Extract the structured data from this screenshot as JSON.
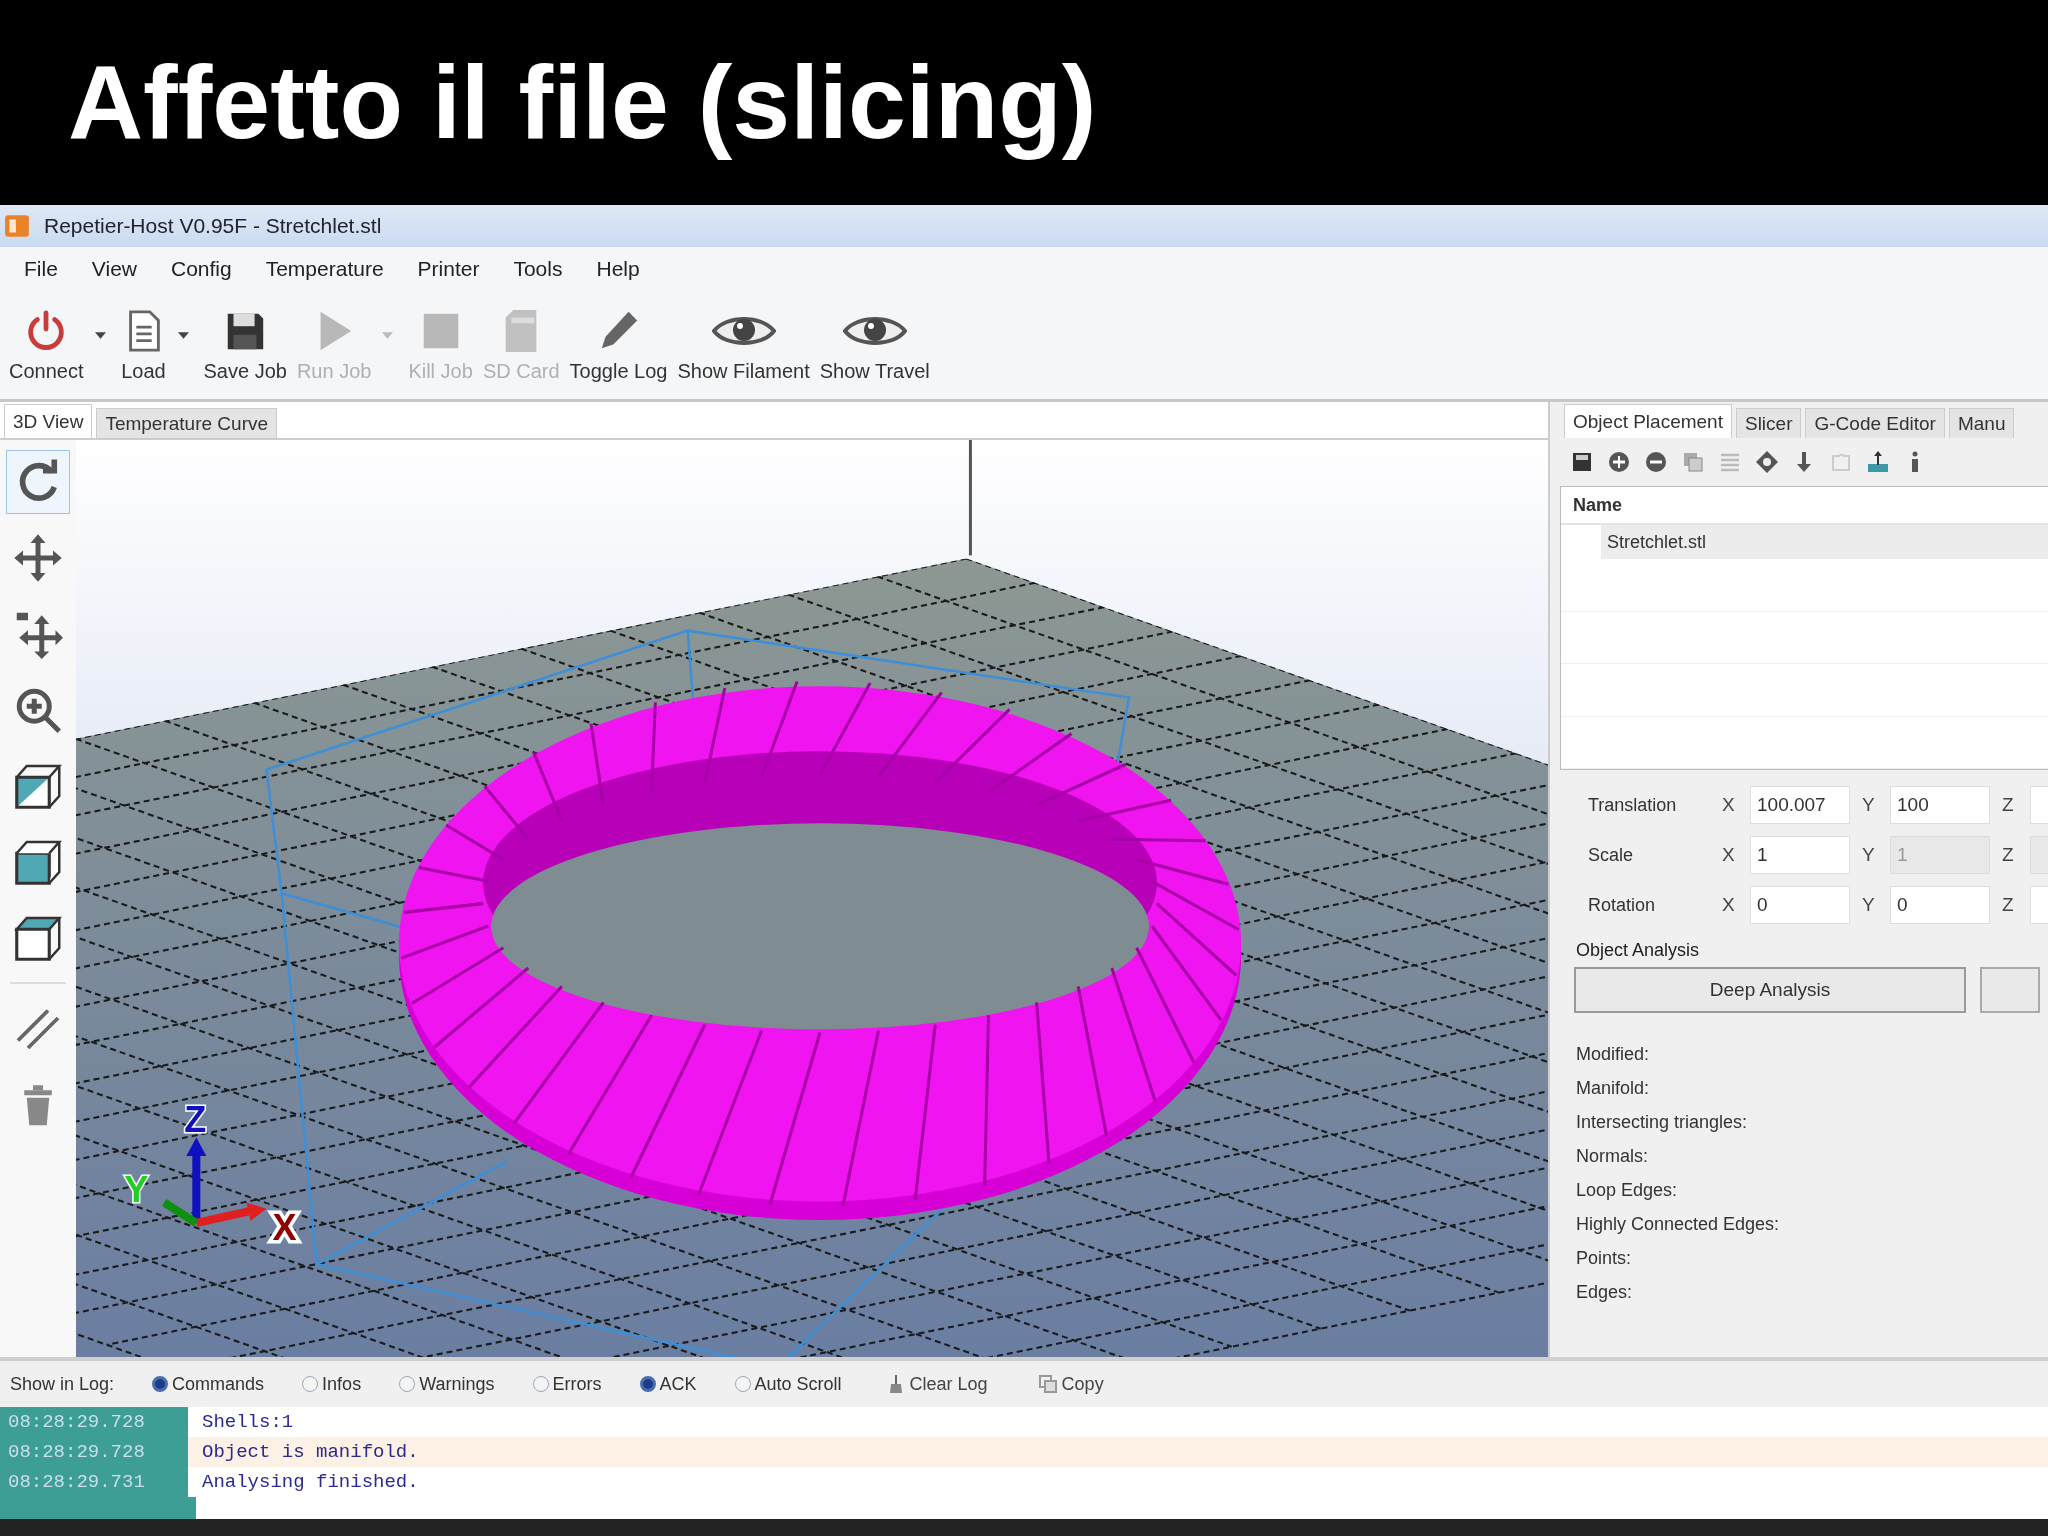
{
  "caption": "Affetto il file (slicing)",
  "window": {
    "title": "Repetier-Host V0.95F - Stretchlet.stl"
  },
  "menu": [
    "File",
    "View",
    "Config",
    "Temperature",
    "Printer",
    "Tools",
    "Help"
  ],
  "toolbar": [
    {
      "kind": "power",
      "label": "Connect",
      "disabled": false,
      "dropdown": true
    },
    {
      "kind": "document",
      "label": "Load",
      "disabled": false,
      "dropdown": true
    },
    {
      "kind": "floppy",
      "label": "Save Job",
      "disabled": false,
      "dropdown": false
    },
    {
      "kind": "play",
      "label": "Run Job",
      "disabled": true,
      "dropdown": true
    },
    {
      "kind": "stop",
      "label": "Kill Job",
      "disabled": true,
      "dropdown": false
    },
    {
      "kind": "sdcard",
      "label": "SD Card",
      "disabled": true,
      "dropdown": false
    },
    {
      "kind": "pencil",
      "label": "Toggle Log",
      "disabled": false,
      "dropdown": false
    },
    {
      "kind": "eye",
      "label": "Show Filament",
      "disabled": false,
      "dropdown": false
    },
    {
      "kind": "eye",
      "label": "Show Travel",
      "disabled": false,
      "dropdown": false
    }
  ],
  "view_tabs": [
    {
      "label": "3D View",
      "selected": true
    },
    {
      "label": "Temperature Curve",
      "selected": false
    }
  ],
  "view_tools": [
    {
      "kind": "rotate",
      "selected": true
    },
    {
      "kind": "move",
      "selected": false
    },
    {
      "kind": "move-object",
      "selected": false
    },
    {
      "kind": "zoom",
      "selected": false
    },
    {
      "kind": "cube-diagonal",
      "selected": false
    },
    {
      "kind": "cube-front",
      "selected": false
    },
    {
      "kind": "cube-top",
      "selected": false
    },
    {
      "kind": "parallel",
      "selected": false
    },
    {
      "kind": "trash",
      "selected": false
    }
  ],
  "scene": {
    "axes": [
      "X",
      "Y",
      "Z"
    ]
  },
  "panel_tabs": [
    {
      "label": "Object Placement",
      "selected": true
    },
    {
      "label": "Slicer",
      "selected": false
    },
    {
      "label": "G-Code Editor",
      "selected": false
    },
    {
      "label": "Manu",
      "selected": false
    }
  ],
  "object_list": {
    "columns": [
      "Name"
    ],
    "rows": [
      "Stretchlet.stl"
    ]
  },
  "transform": [
    {
      "label": "Translation",
      "fields": [
        {
          "axis": "X",
          "value": "100.007",
          "disabled": false
        },
        {
          "axis": "Y",
          "value": "100",
          "disabled": false
        },
        {
          "axis": "Z",
          "disabled": false
        }
      ]
    },
    {
      "label": "Scale",
      "fields": [
        {
          "axis": "X",
          "value": "1",
          "disabled": false
        },
        {
          "axis": "Y",
          "value": "1",
          "disabled": true
        },
        {
          "axis": "Z",
          "disabled": true
        }
      ]
    },
    {
      "label": "Rotation",
      "fields": [
        {
          "axis": "X",
          "value": "0",
          "disabled": false
        },
        {
          "axis": "Y",
          "value": "0",
          "disabled": false
        },
        {
          "axis": "Z",
          "disabled": false
        }
      ]
    }
  ],
  "analysis": {
    "title": "Object Analysis",
    "button": "Deep Analysis",
    "labels": [
      "Modified:",
      "Manifold:",
      "Intersecting triangles:",
      "Normals:",
      "Loop Edges:",
      "Highly Connected Edges:",
      "Points:",
      "Edges:"
    ]
  },
  "log_bar": {
    "label": "Show in Log:",
    "filters": [
      {
        "label": "Commands",
        "checked": true
      },
      {
        "label": "Infos",
        "checked": false
      },
      {
        "label": "Warnings",
        "checked": false
      },
      {
        "label": "Errors",
        "checked": false
      },
      {
        "label": "ACK",
        "checked": true
      },
      {
        "label": "Auto Scroll",
        "checked": false
      }
    ],
    "actions": [
      {
        "kind": "broom",
        "label": "Clear Log"
      },
      {
        "kind": "copy",
        "label": "Copy"
      }
    ]
  },
  "log": [
    {
      "time": "08:28:29.728",
      "text": "Shells:1",
      "highlighted": false
    },
    {
      "time": "08:28:29.728",
      "text": "Object is manifold.",
      "highlighted": true
    },
    {
      "time": "08:28:29.731",
      "text": "Analysing finished.",
      "highlighted": false
    }
  ]
}
